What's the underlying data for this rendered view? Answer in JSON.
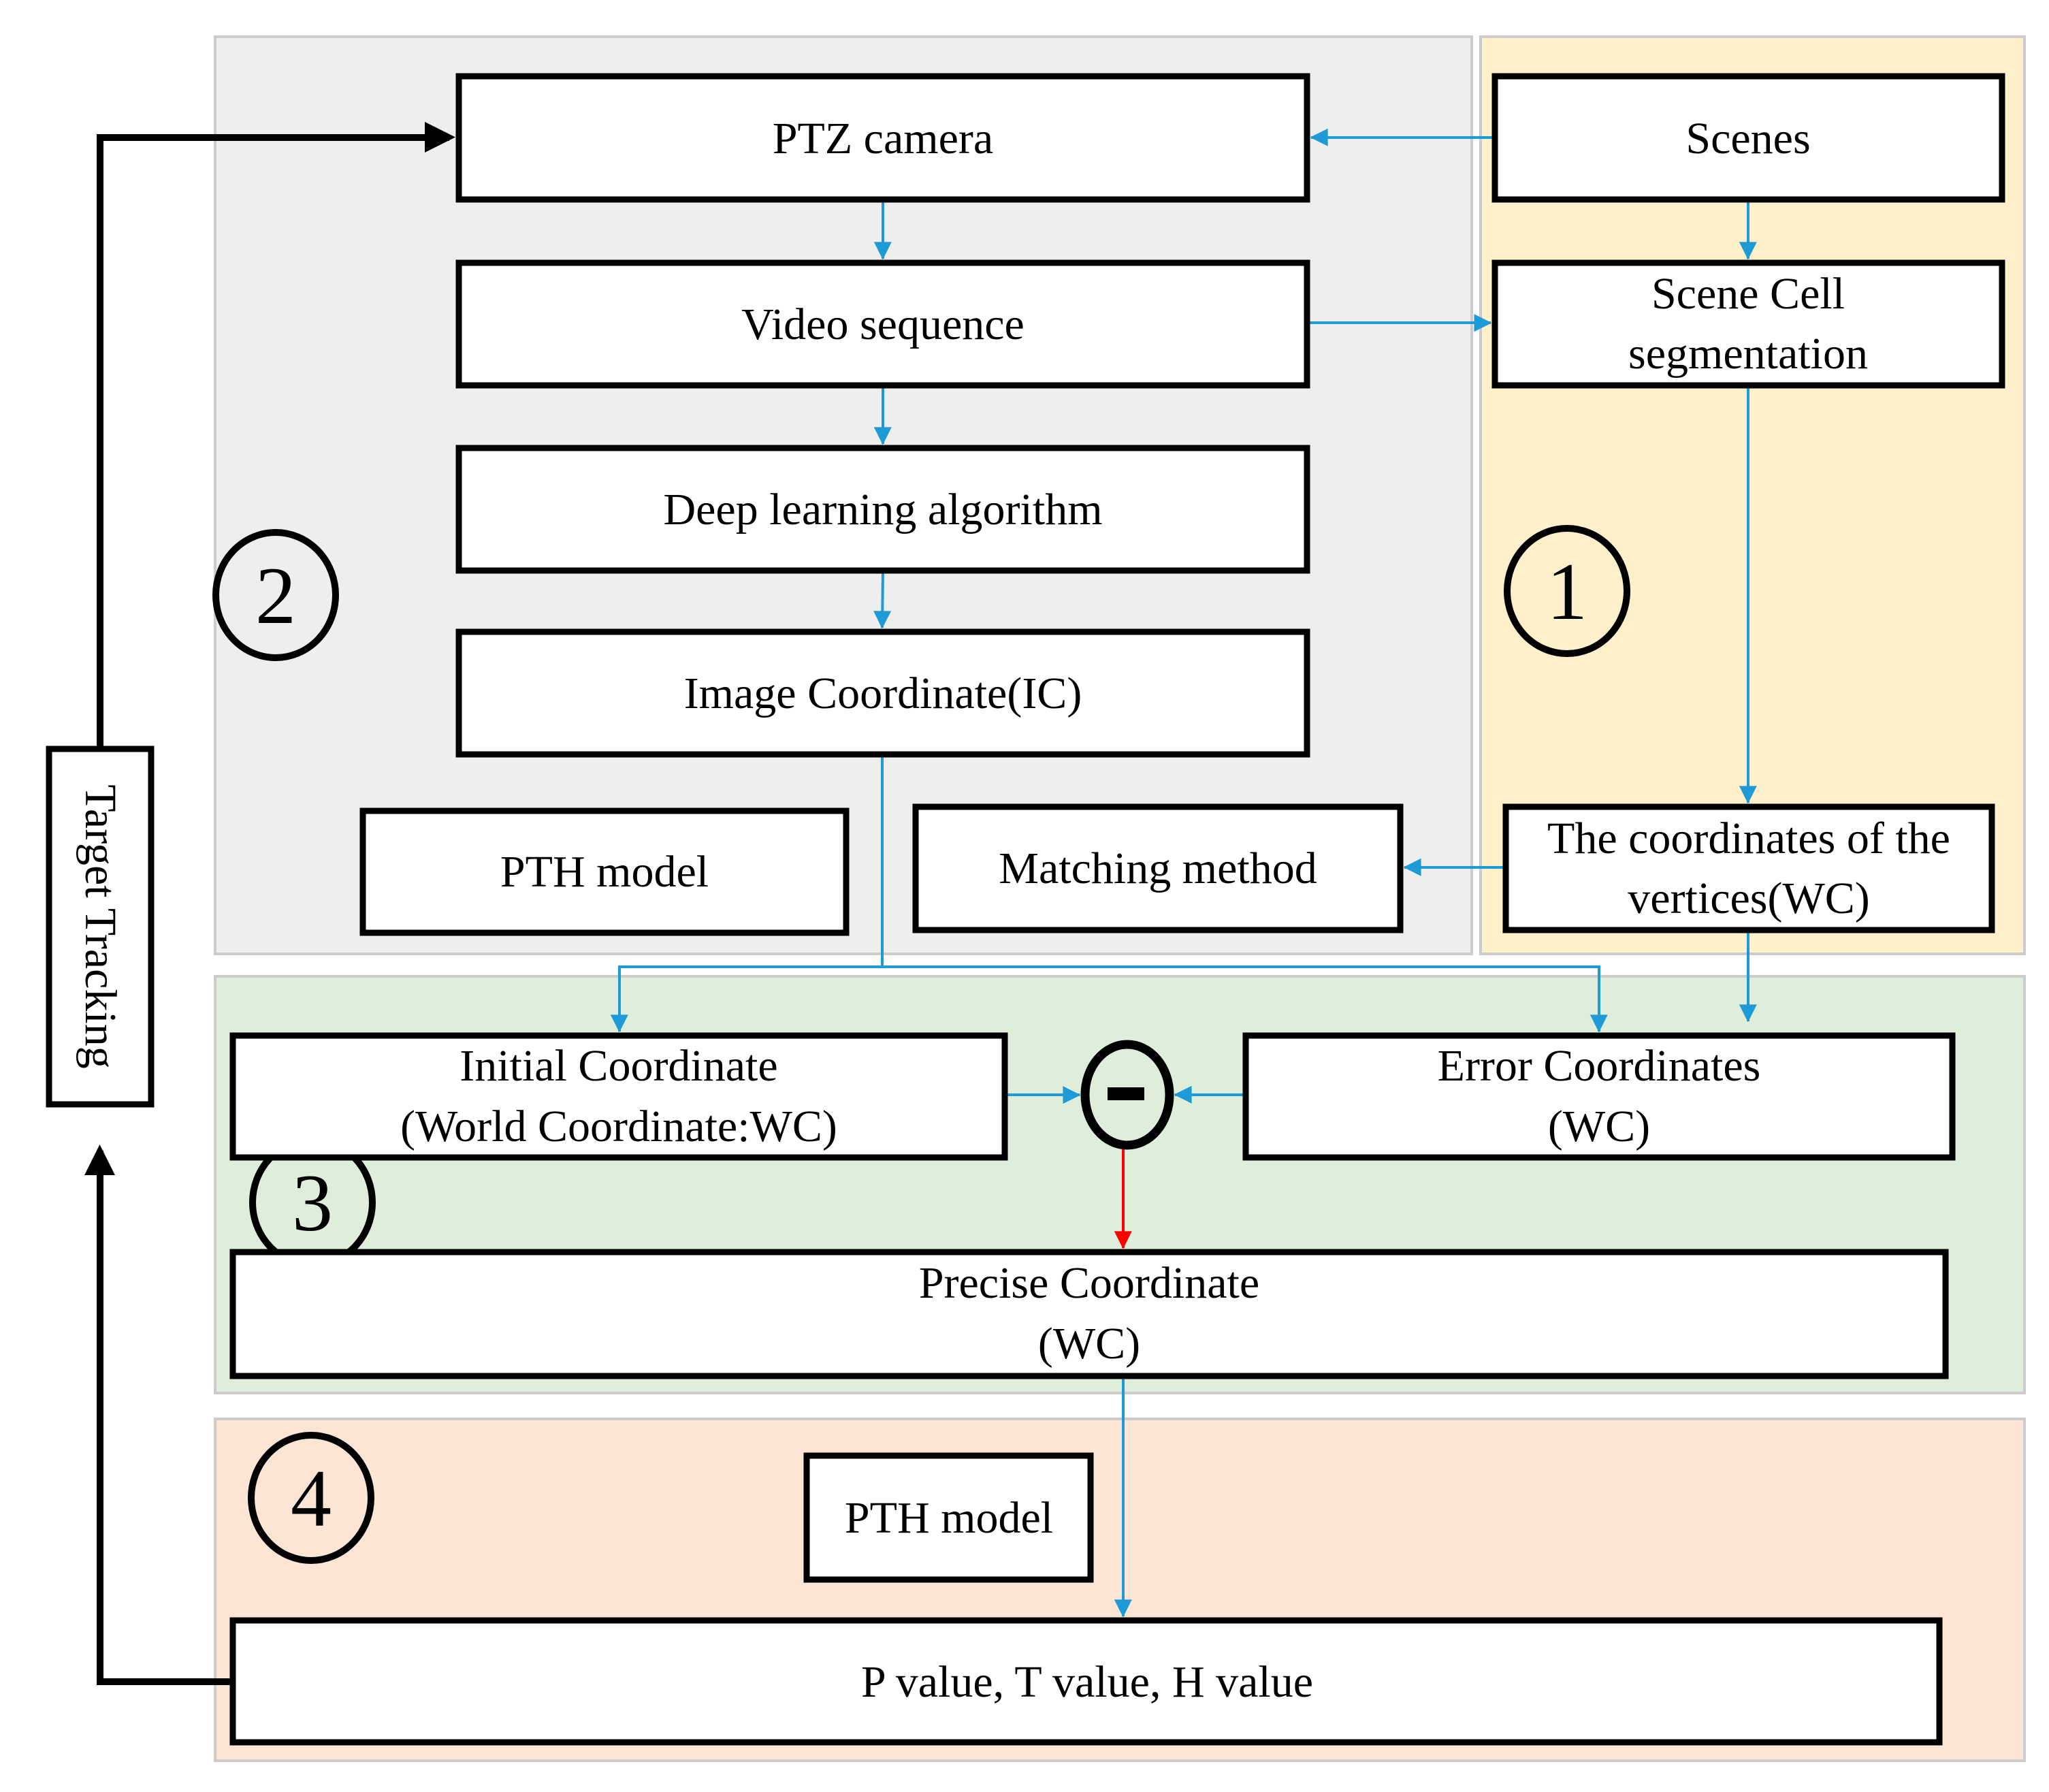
{
  "colors": {
    "panel_gray": "#eeeeee",
    "panel_yellow": "#fff0cc",
    "panel_green": "#deeeda",
    "panel_peach": "#fde5d6",
    "arrow_blue": "#1e9bd7",
    "arrow_red": "#ff0000",
    "black": "#000000"
  },
  "sections": {
    "s1": "1",
    "s2": "2",
    "s3": "3",
    "s4": "4"
  },
  "nodes": {
    "ptz_camera": "PTZ camera",
    "video_sequence": "Video sequence",
    "deep_learning": "Deep learning algorithm",
    "image_coordinate": "Image Coordinate(IC)",
    "pth_model_top": "PTH model",
    "matching_method": "Matching method",
    "scenes": "Scenes",
    "scene_cell": [
      "Scene Cell",
      "segmentation"
    ],
    "vertices": [
      "The coordinates of the",
      "vertices(WC)"
    ],
    "initial_coordinate": [
      "Initial Coordinate",
      "(World Coordinate:WC)"
    ],
    "minus_operator": "-",
    "error_coordinates": [
      "Error Coordinates",
      "(WC)"
    ],
    "precise_coordinate": [
      "Precise Coordinate",
      "(WC)"
    ],
    "pth_model_bottom": "PTH model",
    "pth_values": "P value, T value, H value",
    "target_tracking": "Target Tracking"
  }
}
